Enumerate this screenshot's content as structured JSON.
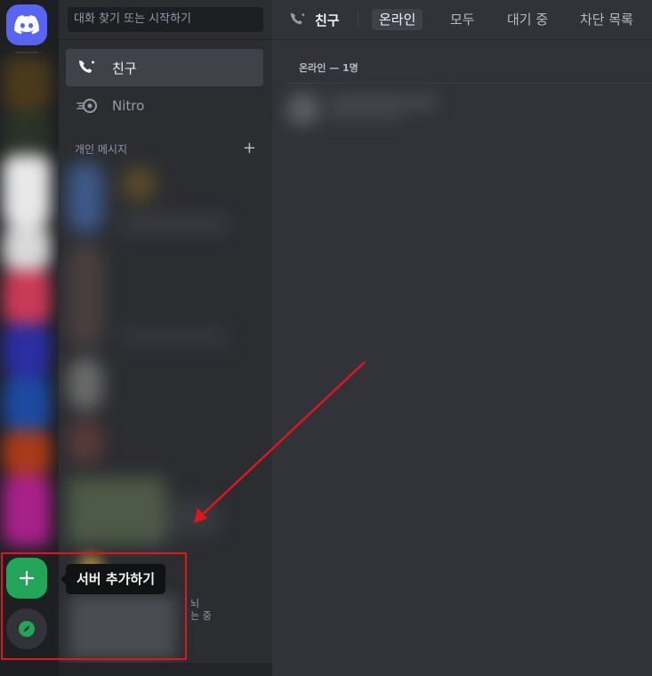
{
  "sidebar": {
    "search_placeholder": "대화 찾기 또는 시작하기",
    "items": [
      {
        "label": "친구",
        "icon": "friends-icon"
      },
      {
        "label": "Nitro",
        "icon": "nitro-icon"
      }
    ],
    "dm_header": "개인 메시지",
    "dm_add": "+",
    "dm_fragment_1": "뇌",
    "dm_fragment_2": "는 중"
  },
  "server_rail": {
    "add_server_tooltip": "서버 추가하기",
    "add_icon": "plus-icon",
    "explore_icon": "compass-icon"
  },
  "header": {
    "title": "친구",
    "tabs": [
      {
        "label": "온라인",
        "active": true
      },
      {
        "label": "모두",
        "active": false
      },
      {
        "label": "대기 중",
        "active": false
      },
      {
        "label": "차단 목록",
        "active": false
      }
    ]
  },
  "main": {
    "section_title": "온라인 — 1명"
  },
  "colors": {
    "brand": "#5865f2",
    "add_server": "#23a559",
    "annotation": "#e0161b"
  }
}
